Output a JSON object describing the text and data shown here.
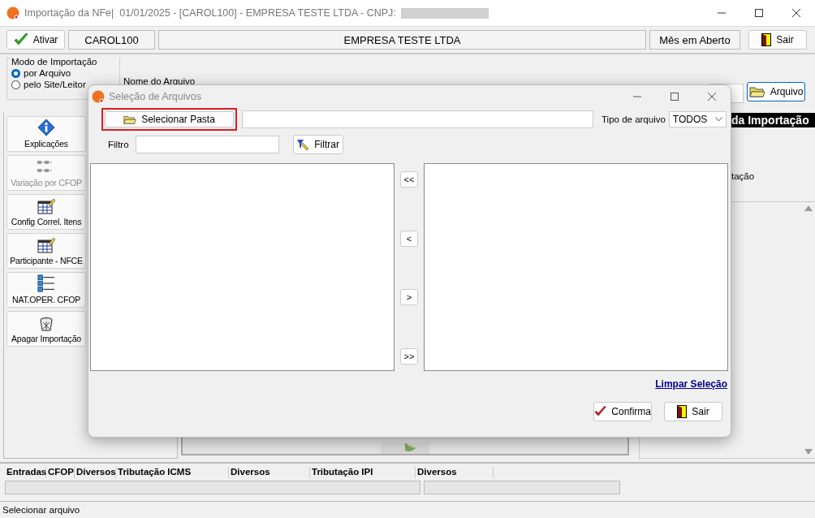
{
  "window": {
    "title": "Importação da NFe|  01/01/2025 - [CAROL100] - EMPRESA TESTE LTDA - CNPJ:"
  },
  "toolbar": {
    "activate_button": "Ativar",
    "user": "CAROL100",
    "company": "EMPRESA TESTE LTDA",
    "period": "Mês em Aberto",
    "exit_button": "Sair"
  },
  "import_mode": {
    "title": "Modo de Importação",
    "options": [
      {
        "label": "por Arquivo",
        "selected": true
      },
      {
        "label": "pelo Site/Leitor",
        "selected": false
      }
    ]
  },
  "file_name": {
    "label": "Nome do Arquivo",
    "button": "Arquivo"
  },
  "sidebar": {
    "items": [
      {
        "label": "Explicações",
        "kind": "info",
        "disabled": false
      },
      {
        "label": "Variação por CFOP",
        "kind": "tree",
        "disabled": true
      },
      {
        "label": "Config Correl. Itens",
        "kind": "sheet",
        "disabled": false
      },
      {
        "label": "Participante - NFCE",
        "kind": "sheet",
        "disabled": false
      },
      {
        "label": "NAT.OPER. CFOP",
        "kind": "list",
        "disabled": false
      },
      {
        "label": "Apagar Importação",
        "kind": "trash",
        "disabled": false
      }
    ]
  },
  "summary": {
    "header": "da Importação",
    "line": "tação"
  },
  "totals": {
    "columns": [
      "Entradas",
      "CFOP",
      "Diversos",
      "Tributação ICMS",
      "Diversos",
      "Tributação IPI",
      "Diversos"
    ]
  },
  "status_bar": "Selecionar arquivo",
  "dialog": {
    "title": "Seleção de Arquivos",
    "select_folder_button": {
      "label": "Selecionar Pasta",
      "highlighted": true
    },
    "file_type": {
      "label": "Tipo de arquivo",
      "value": "TODOS"
    },
    "filter": {
      "label": "Filtro",
      "button": "Filtrar"
    },
    "move_buttons": [
      "<<",
      "<",
      ">",
      ">>"
    ],
    "clear_link": "Limpar Seleção",
    "buttons": [
      {
        "label": "Confirma",
        "kind": "confirm"
      },
      {
        "label": "Sair",
        "kind": "exit"
      }
    ]
  }
}
